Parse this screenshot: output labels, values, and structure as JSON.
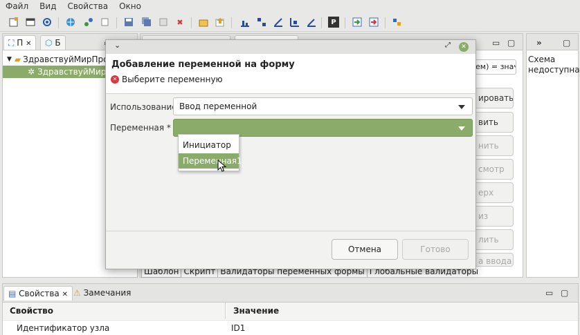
{
  "menu": {
    "items": [
      "Файл",
      "Вид",
      "Свойства",
      "Окно"
    ]
  },
  "left_panel": {
    "tabs": [
      "П",
      "Б"
    ],
    "tree": [
      {
        "label": "ЗдравствуйМирПрое",
        "level": 0,
        "expanded": true
      },
      {
        "label": "ЗдравствуйМир",
        "level": 1,
        "selected": true
      }
    ]
  },
  "right_panel": {
    "message": "Схема недоступна."
  },
  "editor": {
    "combo_fragment": "ем) = знач",
    "side_buttons": [
      {
        "label": "ировать",
        "enabled": true
      },
      {
        "label": "вить",
        "enabled": true
      },
      {
        "label": "нить",
        "enabled": false
      },
      {
        "label": "смотр",
        "enabled": false
      },
      {
        "label": "ерх",
        "enabled": false
      },
      {
        "label": "из",
        "enabled": false
      },
      {
        "label": "лить",
        "enabled": false
      },
      {
        "label": "а ввода",
        "enabled": false
      }
    ],
    "bottom_tabs": [
      "Шаблон",
      "Скрипт",
      "Валидаторы переменных формы",
      "Глобальные валидаторы"
    ]
  },
  "dialog": {
    "title": "Добавление переменной на форму",
    "error_message": "Выберите переменную",
    "usage_label": "Использование",
    "usage_value": "Ввод переменной",
    "variable_label": "Переменная *",
    "variable_value": "",
    "dropdown_options": [
      "Инициатор",
      "Переменная1"
    ],
    "highlighted_option": "Переменная1",
    "cancel_label": "Отмена",
    "ok_label": "Готово"
  },
  "properties": {
    "tabs": [
      "Свойства",
      "Замечания"
    ],
    "columns": [
      "Свойство",
      "Значение"
    ],
    "rows": [
      {
        "property": "Идентификатор узла",
        "value": "ID1"
      }
    ]
  },
  "colors": {
    "accent_green": "#8bab6a",
    "error_red": "#d9363e"
  }
}
